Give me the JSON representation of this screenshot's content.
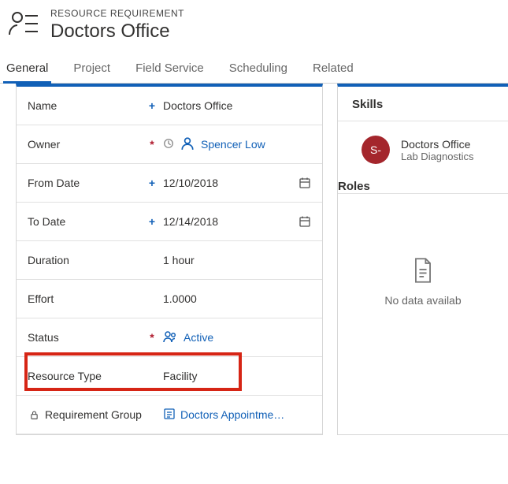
{
  "header": {
    "entity_type": "RESOURCE REQUIREMENT",
    "entity_name": "Doctors Office"
  },
  "tabs": [
    {
      "label": "General",
      "active": true
    },
    {
      "label": "Project",
      "active": false
    },
    {
      "label": "Field Service",
      "active": false
    },
    {
      "label": "Scheduling",
      "active": false
    },
    {
      "label": "Related",
      "active": false
    }
  ],
  "fields": {
    "name": {
      "label": "Name",
      "value": "Doctors Office",
      "indicator": "+"
    },
    "owner": {
      "label": "Owner",
      "value": "Spencer Low",
      "indicator": "*"
    },
    "from_date": {
      "label": "From Date",
      "value": "12/10/2018",
      "indicator": "+"
    },
    "to_date": {
      "label": "To Date",
      "value": "12/14/2018",
      "indicator": "+"
    },
    "duration": {
      "label": "Duration",
      "value": "1 hour"
    },
    "effort": {
      "label": "Effort",
      "value": "1.0000"
    },
    "status": {
      "label": "Status",
      "value": "Active",
      "indicator": "*"
    },
    "resource_type": {
      "label": "Resource Type",
      "value": "Facility"
    },
    "requirement_group": {
      "label": "Requirement Group",
      "value": "Doctors Appointme…"
    }
  },
  "right": {
    "skills_title": "Skills",
    "skill": {
      "avatar_initials": "S‑",
      "line1": "Doctors Office",
      "line2": "Lab Diagnostics"
    },
    "roles_title": "Roles",
    "empty_text": "No data availab"
  }
}
